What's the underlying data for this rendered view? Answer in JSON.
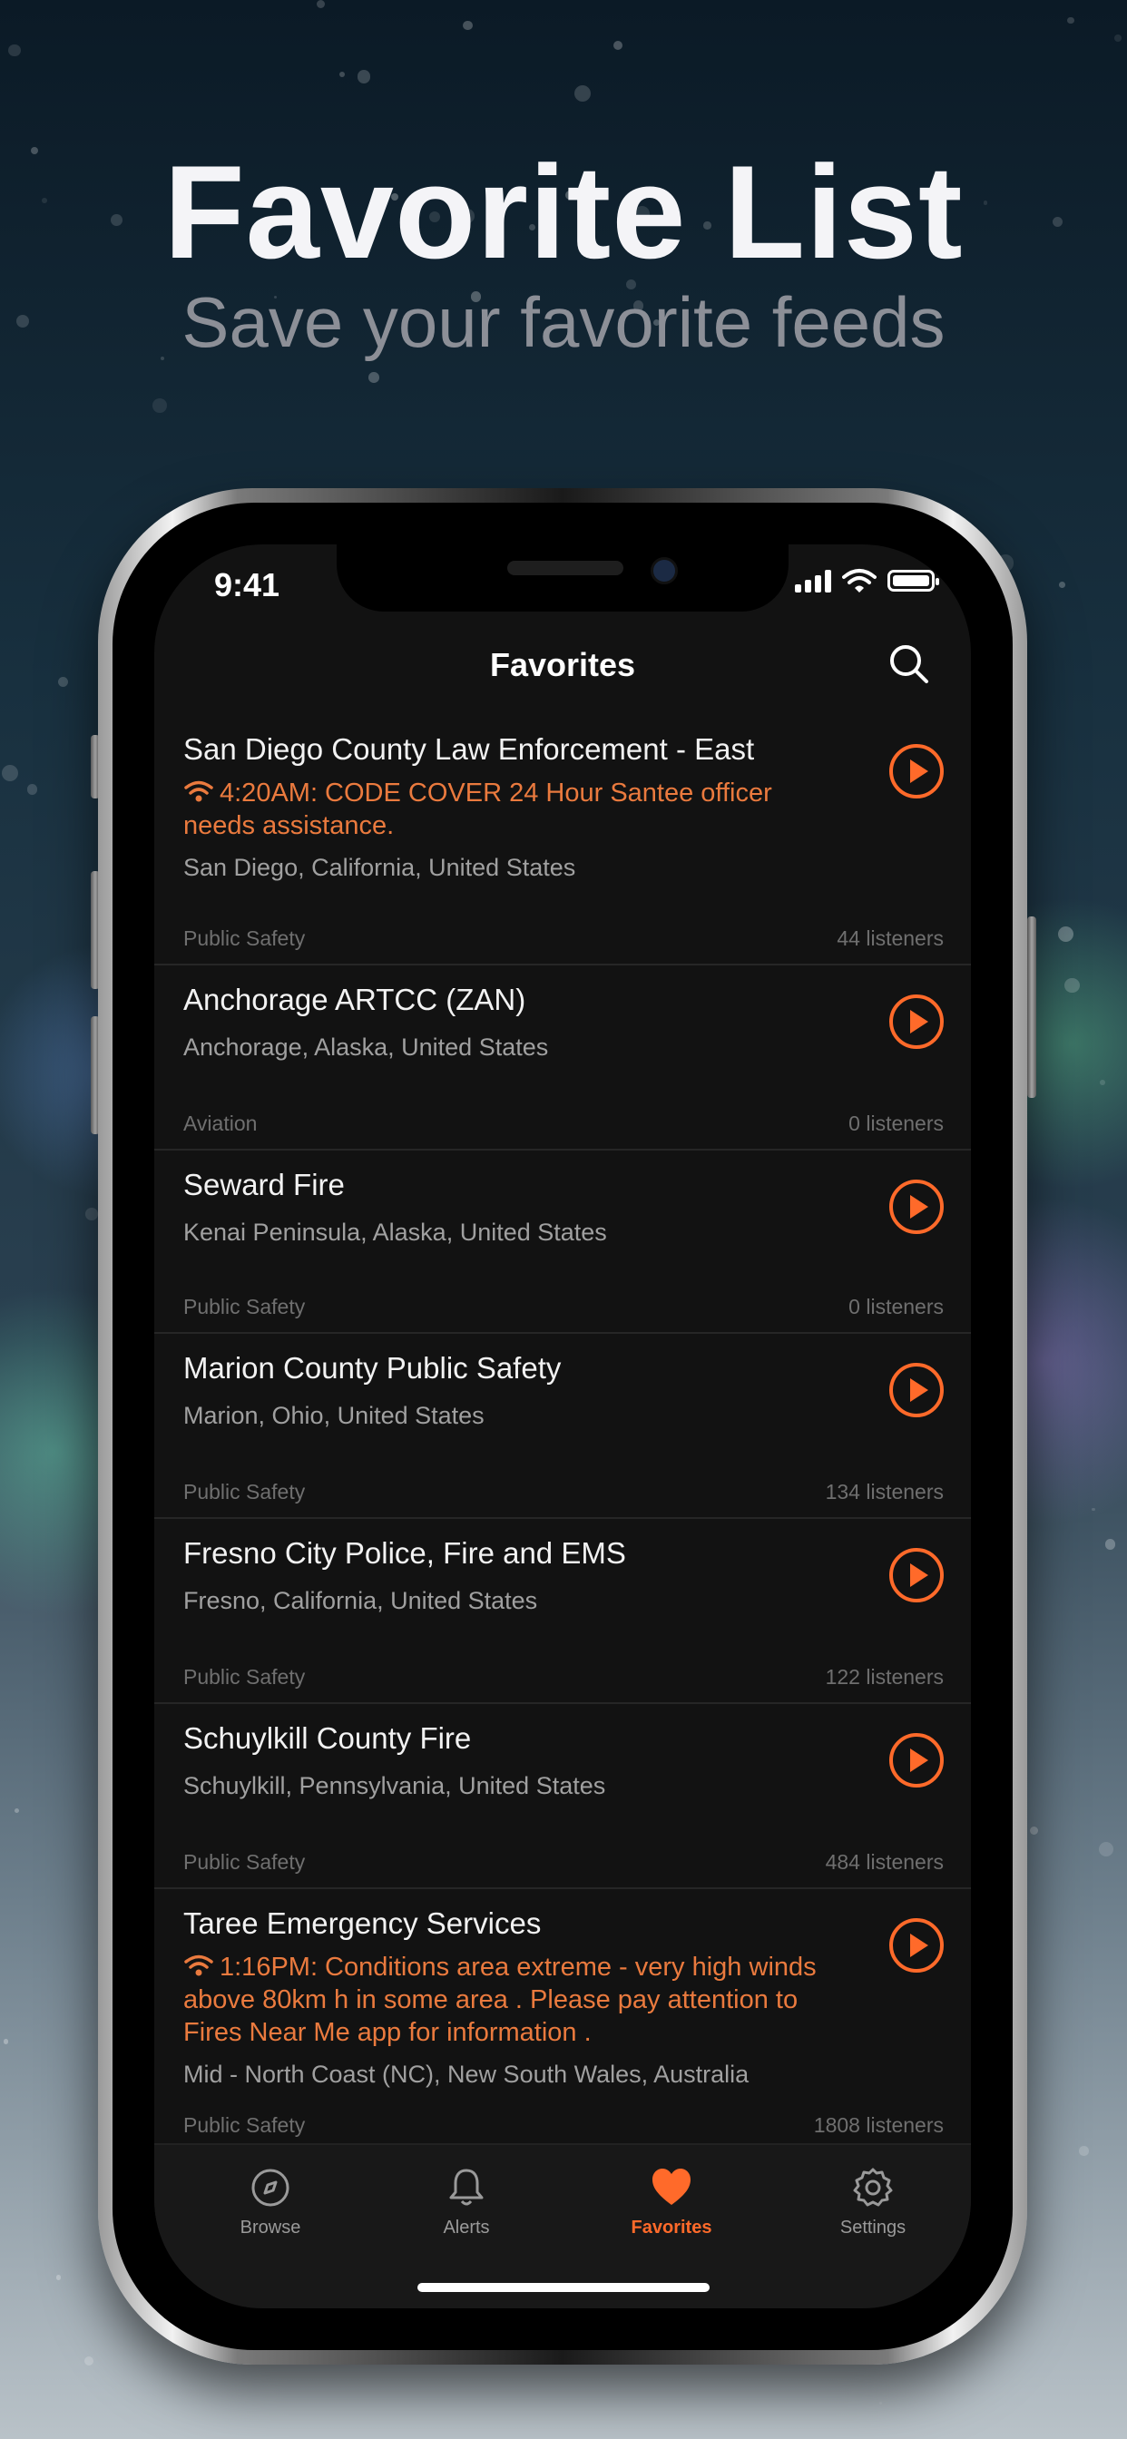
{
  "hero": {
    "title": "Favorite List",
    "subtitle": "Save your favorite feeds"
  },
  "status_bar": {
    "time": "9:41"
  },
  "nav": {
    "title": "Favorites",
    "search_icon": "search-icon"
  },
  "colors": {
    "accent": "#ff6a2a",
    "alert_text": "#ea7a3e",
    "screen_bg": "#121212"
  },
  "feeds": [
    {
      "name": "San Diego County Law Enforcement - East",
      "alert": "4:20AM: CODE COVER 24 Hour Santee officer needs assistance.",
      "location": "San Diego, California, United States",
      "category": "Public Safety",
      "listeners": "44 listeners"
    },
    {
      "name": "Anchorage ARTCC (ZAN)",
      "alert": "",
      "location": "Anchorage, Alaska, United States",
      "category": "Aviation",
      "listeners": "0 listeners"
    },
    {
      "name": "Seward Fire",
      "alert": "",
      "location": "Kenai Peninsula, Alaska, United States",
      "category": "Public Safety",
      "listeners": "0 listeners"
    },
    {
      "name": "Marion County Public Safety",
      "alert": "",
      "location": "Marion, Ohio, United States",
      "category": "Public Safety",
      "listeners": "134 listeners"
    },
    {
      "name": "Fresno City Police, Fire and EMS",
      "alert": "",
      "location": "Fresno, California, United States",
      "category": "Public Safety",
      "listeners": "122 listeners"
    },
    {
      "name": "Schuylkill County Fire",
      "alert": "",
      "location": "Schuylkill, Pennsylvania, United States",
      "category": "Public Safety",
      "listeners": "484 listeners"
    },
    {
      "name": "Taree Emergency Services",
      "alert": "1:16PM: Conditions area extreme - very high winds above 80km h in some area . Please pay attention to Fires Near Me app for information .",
      "location": "Mid - North Coast (NC), New South Wales, Australia",
      "category": "Public Safety",
      "listeners": "1808 listeners"
    }
  ],
  "tabs": [
    {
      "label": "Browse",
      "icon": "compass-icon",
      "active": false
    },
    {
      "label": "Alerts",
      "icon": "bell-icon",
      "active": false
    },
    {
      "label": "Favorites",
      "icon": "heart-icon",
      "active": true
    },
    {
      "label": "Settings",
      "icon": "gear-icon",
      "active": false
    }
  ]
}
